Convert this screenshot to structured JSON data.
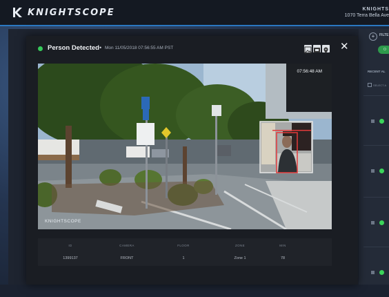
{
  "app": {
    "logo_text": "KNIGHTSCOPE",
    "site_name": "KNIGHTS",
    "site_address": "1070 Terra Bella Ave"
  },
  "right_panel": {
    "add_icon": "plus-circle-icon",
    "filter_label": "FILTE",
    "recent_label": "RECENT AL",
    "select_all_label": "SELECT A",
    "alerts": [
      {
        "status_color": "#3bd45a"
      },
      {
        "status_color": "#3bd45a"
      },
      {
        "status_color": "#3bd45a"
      },
      {
        "status_color": "#3bd45a"
      }
    ]
  },
  "modal": {
    "status_color": "#36c95a",
    "title": "Person Detected",
    "separator": "•",
    "timestamp": "Mon 11/05/2018 07:56:55 AM PST",
    "header_icons": [
      "image-icon",
      "video-icon",
      "map-pin-icon"
    ],
    "close_label": "✕",
    "photo": {
      "timestamp_overlay": "07:56:48 AM",
      "watermark": "KNIGHTSCOPE"
    },
    "details": {
      "headers": [
        "ID",
        "CAMERA",
        "FLOOR",
        "ZONE",
        "MIN"
      ],
      "values": [
        "1399137",
        "FRONT",
        "1",
        "Zone 1",
        "78"
      ]
    }
  }
}
